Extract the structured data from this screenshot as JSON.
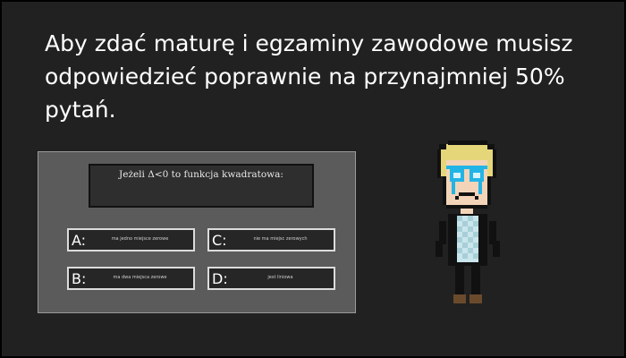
{
  "headline": "Aby zdać maturę i egzaminy zawodowe musisz odpowiedzieć poprawnie na przynajmniej 50% pytań.",
  "quiz": {
    "question": "Jeżeli Δ<0 to funkcja kwadratowa:",
    "answers": [
      {
        "letter": "A:",
        "text": "ma jedno miejsce zerowe"
      },
      {
        "letter": "B:",
        "text": "ma dwa miejsca zerowe"
      },
      {
        "letter": "C:",
        "text": "nie ma miejsc zerowych"
      },
      {
        "letter": "D:",
        "text": "jest liniowa"
      }
    ]
  },
  "character": {
    "icon": "crying-pixel-student-icon",
    "hair_color": "#e6d67a",
    "glasses_color": "#23b4e6",
    "skin_color": "#f3d4b8",
    "shirt_color": "#c9e6ec"
  }
}
